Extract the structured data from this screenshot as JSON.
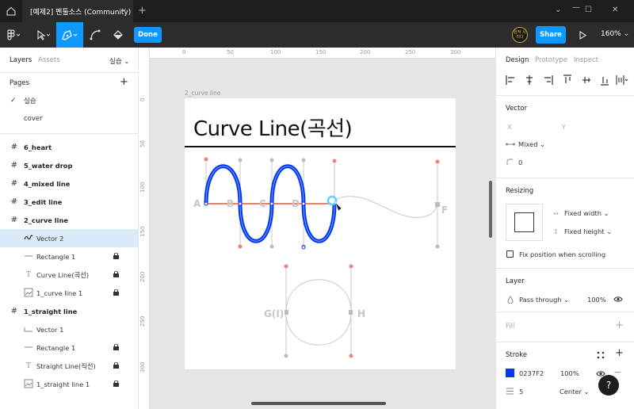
{
  "titlebar": {
    "tab_title": "[예제2] 펜툴소스 (Community)",
    "tab_close": "×",
    "new_tab": "+",
    "minimize": "—",
    "maximize": "☐",
    "close": "✕"
  },
  "toolbar": {
    "done_label": "Done",
    "share_label": "Share",
    "zoom": "160%",
    "avatar_text": "원작 시리다"
  },
  "left_panel": {
    "tabs": {
      "layers": "Layers",
      "assets": "Assets",
      "page_switch": "실습 ⌄"
    },
    "pages_title": "Pages",
    "add_page": "+",
    "pages": [
      {
        "label": "실습",
        "current": true
      },
      {
        "label": "cover",
        "current": false
      }
    ],
    "layers": [
      {
        "label": "6_heart",
        "type": "frame"
      },
      {
        "label": "5_water drop",
        "type": "frame"
      },
      {
        "label": "4_mixed line",
        "type": "frame"
      },
      {
        "label": "3_edit line",
        "type": "frame"
      },
      {
        "label": "2_curve line",
        "type": "frame"
      },
      {
        "label": "Vector 2",
        "type": "vector",
        "selected": true
      },
      {
        "label": "Rectangle 1",
        "type": "rect",
        "locked": true
      },
      {
        "label": "Curve Line(곡선)",
        "type": "text",
        "locked": true
      },
      {
        "label": "1_curve line 1",
        "type": "image",
        "locked": true
      },
      {
        "label": "1_straight line",
        "type": "frame"
      },
      {
        "label": "Vector 1",
        "type": "vector"
      },
      {
        "label": "Rectangle 1",
        "type": "rect",
        "locked": true
      },
      {
        "label": "Straight Line(직선)",
        "type": "text",
        "locked": true
      },
      {
        "label": "1_straight line 1",
        "type": "image",
        "locked": true
      }
    ]
  },
  "canvas": {
    "ruler_top": [
      "0",
      "50",
      "100",
      "150",
      "200",
      "250",
      "300"
    ],
    "ruler_left": [
      "0",
      "50",
      "100",
      "150",
      "200",
      "250",
      "300"
    ],
    "frame_label": "2_curve line",
    "frame_title": "Curve Line(곡선)",
    "point_labels": [
      "A",
      "B",
      "C",
      "D",
      "F",
      "G(I)",
      "H"
    ],
    "stroke_color": "#0237F2",
    "handle_color": "#F0817E"
  },
  "right_panel": {
    "tabs": {
      "design": "Design",
      "prototype": "Prototype",
      "inspect": "Inspect"
    },
    "vector": {
      "title": "Vector",
      "x_label": "X",
      "y_label": "Y",
      "mirroring": "Mixed ⌄",
      "corner_radius": "0"
    },
    "resizing": {
      "title": "Resizing",
      "width_mode": "Fixed width ⌄",
      "height_mode": "Fixed height ⌄",
      "fix_position": "Fix position when scrolling"
    },
    "layer": {
      "title": "Layer",
      "blend": "Pass through ⌄",
      "opacity": "100%"
    },
    "fill": {
      "title": "Fill",
      "add": "+"
    },
    "stroke": {
      "title": "Stroke",
      "add": "+",
      "remove": "—",
      "color_hex": "0237F2",
      "color": "#0237F2",
      "opacity": "100%",
      "weight": "5",
      "position": "Center ⌄"
    }
  },
  "help": "?"
}
